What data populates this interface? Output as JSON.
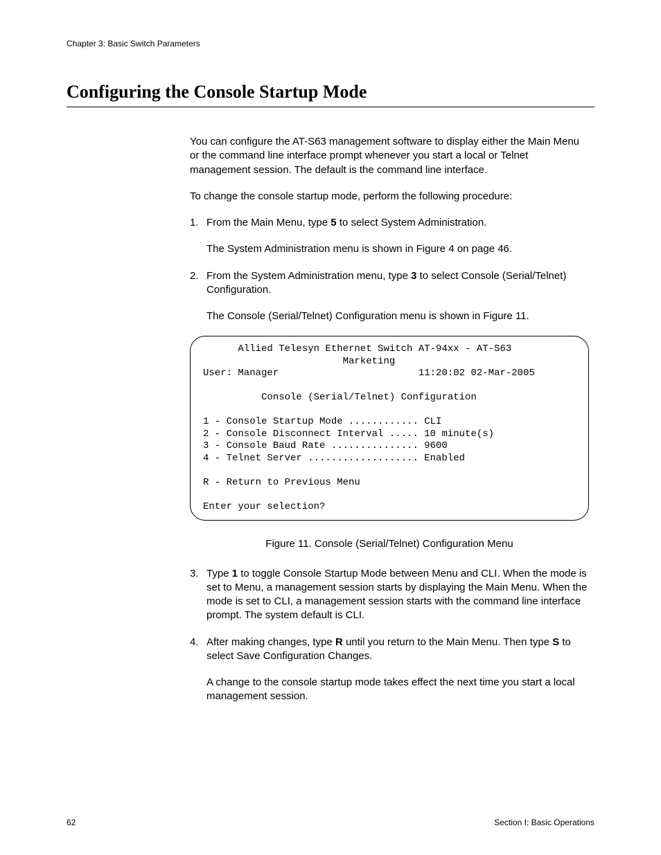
{
  "header": {
    "chapter": "Chapter 3: Basic Switch Parameters"
  },
  "title": "Configuring the Console Startup Mode",
  "intro": {
    "p1": "You can configure the AT-S63 management software to display either the Main Menu or the command line interface prompt whenever you start a local or Telnet management session. The default is the command line interface.",
    "p2": "To change the console startup mode, perform the following procedure:"
  },
  "steps": {
    "s1": {
      "num": "1.",
      "text_a": "From the Main Menu, type ",
      "bold_a": "5",
      "text_b": " to select System Administration.",
      "sub": "The System Administration menu is shown in Figure 4 on page 46."
    },
    "s2": {
      "num": "2.",
      "text_a": "From the System Administration menu, type ",
      "bold_a": "3",
      "text_b": " to select Console (Serial/Telnet) Configuration.",
      "sub": "The Console (Serial/Telnet) Configuration menu is shown in Figure 11."
    },
    "s3": {
      "num": "3.",
      "text_a": "Type ",
      "bold_a": "1",
      "text_b": " to toggle Console Startup Mode between Menu and CLI. When the mode is set to Menu, a management session starts by displaying the Main Menu. When the mode is set to CLI, a management session starts with the command line interface prompt. The system default is CLI."
    },
    "s4": {
      "num": "4.",
      "text_a": "After making changes, type ",
      "bold_a": "R",
      "text_b": " until you return to the Main Menu. Then type ",
      "bold_b": "S",
      "text_c": " to select Save Configuration Changes.",
      "sub": "A change to the console startup mode takes effect the next time you start a local management session."
    }
  },
  "terminal": {
    "line1": "      Allied Telesyn Ethernet Switch AT-94xx - AT-S63",
    "line2": "                        Marketing",
    "line3": "User: Manager                        11:20:02 02-Mar-2005",
    "line4": "",
    "line5": "          Console (Serial/Telnet) Configuration",
    "line6": "",
    "line7": "1 - Console Startup Mode ............ CLI",
    "line8": "2 - Console Disconnect Interval ..... 10 minute(s)",
    "line9": "3 - Console Baud Rate ............... 9600",
    "line10": "4 - Telnet Server ................... Enabled",
    "line11": "",
    "line12": "R - Return to Previous Menu",
    "line13": "",
    "line14": "Enter your selection?"
  },
  "figure_caption": "Figure 11. Console (Serial/Telnet) Configuration Menu",
  "footer": {
    "page": "62",
    "section": "Section I: Basic Operations"
  }
}
